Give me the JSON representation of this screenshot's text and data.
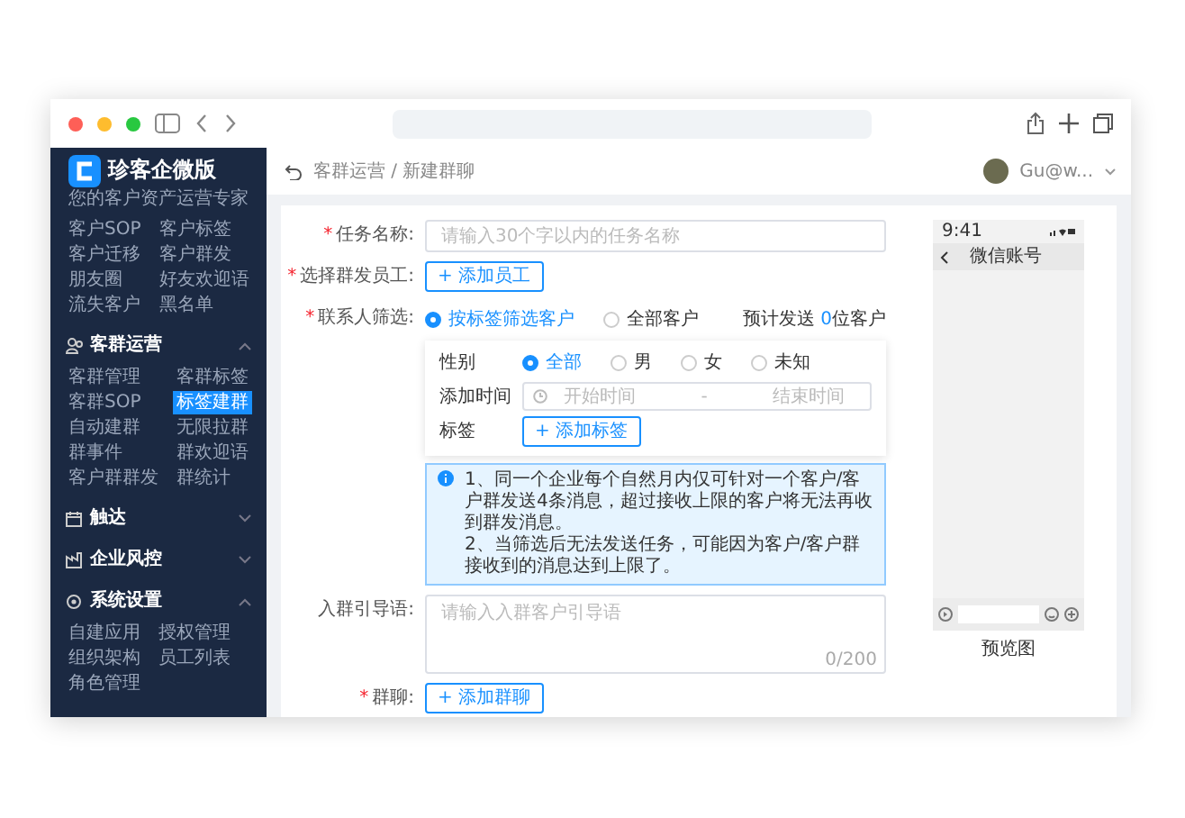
{
  "sidebar": {
    "logo": {
      "title": "珍客企微版",
      "subtitle": "您的客户资产运营专家"
    },
    "sections": [
      {
        "items": [
          {
            "label": "客户SOP",
            "selected": false
          },
          {
            "label": "客户标签",
            "selected": false
          },
          {
            "label": "客户迁移",
            "selected": false
          },
          {
            "label": "客户群发",
            "selected": false
          },
          {
            "label": "朋友圈",
            "selected": false
          },
          {
            "label": "好友欢迎语",
            "selected": false
          },
          {
            "label": "流失客户",
            "selected": false
          },
          {
            "label": "黑名单",
            "selected": false
          }
        ]
      },
      {
        "title": "客群运营",
        "expanded": true,
        "items": [
          {
            "label": "客群管理",
            "selected": false
          },
          {
            "label": "客群标签",
            "selected": false
          },
          {
            "label": "客群SOP",
            "selected": false
          },
          {
            "label": "标签建群",
            "selected": true
          },
          {
            "label": "自动建群",
            "selected": false
          },
          {
            "label": "无限拉群",
            "selected": false
          },
          {
            "label": "群事件",
            "selected": false
          },
          {
            "label": "群欢迎语",
            "selected": false
          },
          {
            "label": "客户群群发",
            "selected": false
          },
          {
            "label": "群统计",
            "selected": false
          }
        ]
      },
      {
        "title": "触达",
        "expanded": false
      },
      {
        "title": "企业风控",
        "expanded": false
      },
      {
        "title": "系统设置",
        "expanded": true,
        "items": [
          {
            "label": "自建应用",
            "selected": false
          },
          {
            "label": "授权管理",
            "selected": false
          },
          {
            "label": "组织架构",
            "selected": false
          },
          {
            "label": "员工列表",
            "selected": false
          },
          {
            "label": "角色管理",
            "selected": false
          }
        ]
      }
    ]
  },
  "header": {
    "breadcrumb": "客群运营 / 新建群聊",
    "user": "Gu@w..."
  },
  "form": {
    "task_name": {
      "label": "任务名称:",
      "required_mark": "*",
      "placeholder": "请输入30个字以内的任务名称"
    },
    "staff": {
      "label": "选择群发员工:",
      "required_mark": "*",
      "button": "+ 添加员工"
    },
    "contacts": {
      "label": "联系人筛选:",
      "required_mark": "*",
      "options": [
        {
          "label": "按标签筛选客户",
          "selected": true
        },
        {
          "label": "全部客户",
          "selected": false
        }
      ],
      "estimate_prefix": "预计发送 ",
      "estimate_count": "0",
      "estimate_suffix": "位客户"
    },
    "filter": {
      "gender_label": "性别",
      "genders": [
        {
          "label": "全部",
          "selected": true
        },
        {
          "label": "男",
          "selected": false
        },
        {
          "label": "女",
          "selected": false
        },
        {
          "label": "未知",
          "selected": false
        }
      ],
      "time_label": "添加时间",
      "start_placeholder": "开始时间",
      "separator": "-",
      "end_placeholder": "结束时间",
      "tag_label": "标签",
      "tag_button": "+ 添加标签"
    },
    "notice": [
      "1、同一个企业每个自然月内仅可针对一个客户/客户群发送4条消息，超过接收上限的客户将无法再收到群发消息。",
      "2、当筛选后无法发送任务，可能因为客户/客户群接收到的消息达到上限了。"
    ],
    "guide": {
      "label": "入群引导语:",
      "placeholder": "请输入入群客户引导语",
      "counter": "0/200"
    },
    "group": {
      "label": "群聊:",
      "required_mark": "*",
      "button": "+ 添加群聊"
    }
  },
  "preview": {
    "time": "9:41",
    "title": "微信账号",
    "caption": "预览图"
  }
}
